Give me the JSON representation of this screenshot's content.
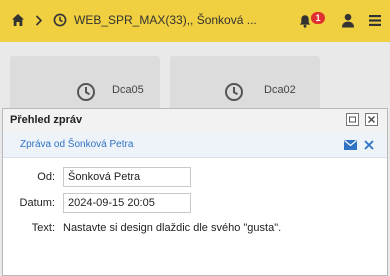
{
  "header": {
    "breadcrumb": "WEB_SPR_MAX(33),, Šonková ...",
    "notification_count": "1"
  },
  "tiles": [
    {
      "label": "Dca05"
    },
    {
      "label": "Dca02"
    }
  ],
  "panel": {
    "title": "Přehled zpráv",
    "message_title": "Zpráva od Šonková Petra",
    "fields": {
      "from_label": "Od:",
      "from_value": "Šonková Petra",
      "date_label": "Datum:",
      "date_value": "2024-09-15 20:05",
      "text_label": "Text:",
      "text_value": "Nastavte si design dlaždic dle svého \"gusta\"."
    }
  },
  "colors": {
    "header_bg": "#f0d040",
    "accent": "#2f73c2",
    "badge": "#e03030"
  }
}
